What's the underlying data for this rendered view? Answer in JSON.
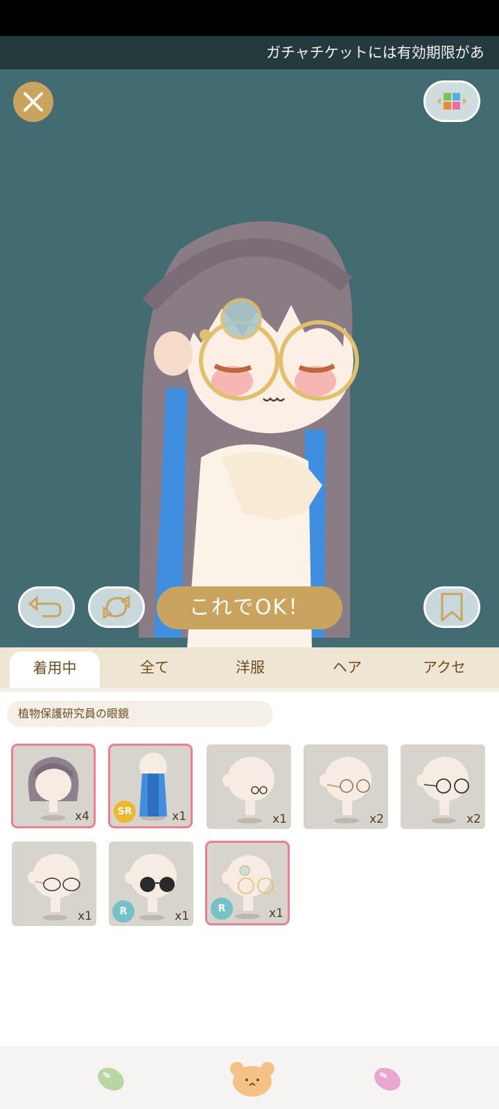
{
  "ticker": {
    "text": "ガチャチケットには有効期限があ"
  },
  "stage": {
    "ok_label": "これでOK！"
  },
  "tabs": [
    {
      "label": "着用中",
      "active": true
    },
    {
      "label": "全て",
      "active": false
    },
    {
      "label": "洋服",
      "active": false
    },
    {
      "label": "ヘア",
      "active": false
    },
    {
      "label": "アクセ",
      "active": false
    }
  ],
  "item_name": "植物保護研究員の眼鏡",
  "items": [
    {
      "qty": "x4",
      "rarity": "",
      "selected": true,
      "kind": "braided-hair"
    },
    {
      "qty": "x1",
      "rarity": "SR",
      "selected": true,
      "kind": "blue-long-hair"
    },
    {
      "qty": "x1",
      "rarity": "",
      "selected": false,
      "kind": "small-round-glasses"
    },
    {
      "qty": "x2",
      "rarity": "",
      "selected": false,
      "kind": "gold-wire-glasses"
    },
    {
      "qty": "x2",
      "rarity": "",
      "selected": false,
      "kind": "black-wire-glasses"
    },
    {
      "qty": "x1",
      "rarity": "",
      "selected": false,
      "kind": "gold-frame-glasses"
    },
    {
      "qty": "x1",
      "rarity": "R",
      "selected": false,
      "kind": "sunglasses"
    },
    {
      "qty": "x1",
      "rarity": "R",
      "selected": true,
      "kind": "monocle-glasses"
    }
  ],
  "colors": {
    "accent_gold": "#c9a45e",
    "stage_bg": "#436b72",
    "selected_border": "#f27b8e"
  },
  "icons": {
    "close": "close-icon",
    "layout": "layout-grid-icon",
    "undo": "undo-icon",
    "random": "refresh-icon",
    "bookmark": "bookmark-icon",
    "nav_left": "green-bean-icon",
    "nav_center": "bear-face-icon",
    "nav_right": "pink-bean-icon"
  }
}
